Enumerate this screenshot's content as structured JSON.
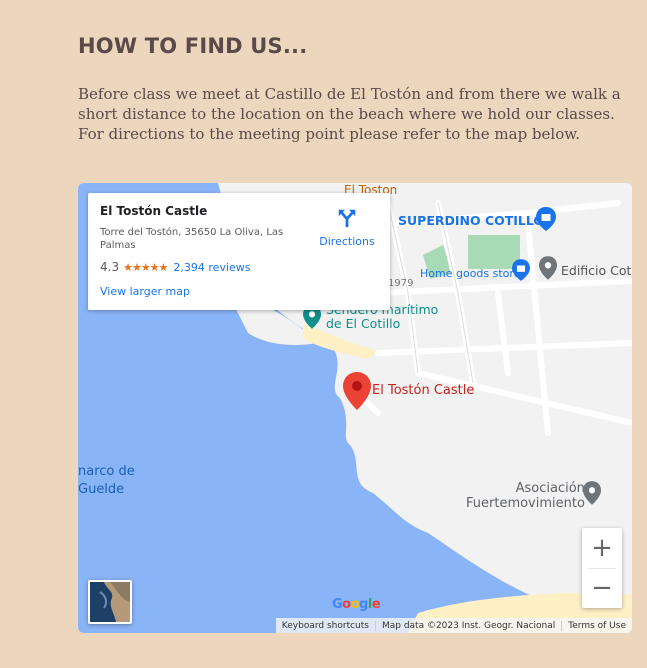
{
  "section": {
    "title": "HOW TO FIND US...",
    "intro": "Before class we meet at Castillo de El Tostón and from there we walk a short distance to the location on the beach where we hold our classes. For directions to the meeting point please refer to the map below."
  },
  "map": {
    "card": {
      "title": "El Tostón Castle",
      "address": "Torre del Tostón, 35650 La Oliva, Las Palmas",
      "rating": "4.3",
      "stars": "★★★★★",
      "reviews": "2,394 reviews",
      "view_larger": "View larger map",
      "directions": "Directions",
      "directions_icon": "directions-icon"
    },
    "labels": {
      "el_toston": "El Toston",
      "superdino": "SUPERDINO COTILLO",
      "home_goods": "Home goods store",
      "edificio": "Edificio Cot",
      "sendero_line1": "Sendero marítimo",
      "sendero_line2": "de El Cotillo",
      "road_1979": "1979",
      "castle": "El Tostón Castle",
      "asociacion_line1": "Asociación",
      "asociacion_line2": "Fuertemovimiento",
      "marco_line1": "narco de",
      "marco_line2": "Guelde"
    },
    "controls": {
      "zoom_in": "+",
      "zoom_out": "−",
      "layer_icon": "satellite-layer-thumbnail"
    },
    "logo": {
      "letters": [
        "G",
        "o",
        "o",
        "g",
        "l",
        "e"
      ],
      "colors": [
        "#4285f4",
        "#ea4335",
        "#fbbc05",
        "#4285f4",
        "#34a853",
        "#ea4335"
      ]
    },
    "attribution": {
      "keyboard": "Keyboard shortcuts",
      "map_data": "Map data ©2023 Inst. Geogr. Nacional",
      "terms": "Terms of Use"
    },
    "colors": {
      "water": "#8ab4f8",
      "land": "#f2f2f2",
      "park": "#a8dab5",
      "sand": "#fdf0c4",
      "pin_red": "#ea4335",
      "teal": "#0e8f8a",
      "blue_poi": "#1a73e8"
    }
  }
}
